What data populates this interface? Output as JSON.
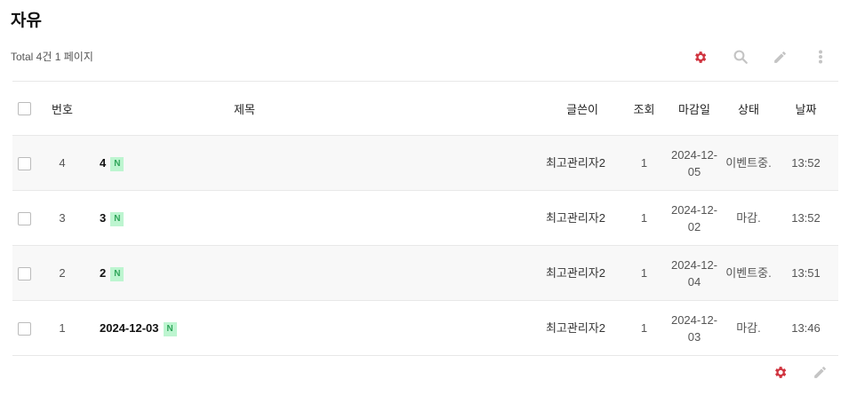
{
  "board": {
    "title": "자유",
    "total_text": "Total 4건 1 페이지"
  },
  "toolbar": {
    "icons": [
      "gear-icon",
      "search-icon",
      "pencil-icon",
      "more-vert-icon"
    ]
  },
  "columns": {
    "num": "번호",
    "subject": "제목",
    "author": "글쓴이",
    "views": "조회",
    "deadline": "마감일",
    "status": "상태",
    "date": "날짜"
  },
  "colors": {
    "accent": "#d0343f",
    "icon_gray": "#c4c4c4",
    "badge_bg": "#bdf5d0",
    "badge_text": "#2fa65a"
  },
  "rows": [
    {
      "num": "4",
      "subject": "4",
      "badge": "N",
      "author": "최고관리자2",
      "views": "1",
      "deadline": "2024-12-05",
      "status": "이벤트중.",
      "date": "13:52"
    },
    {
      "num": "3",
      "subject": "3",
      "badge": "N",
      "author": "최고관리자2",
      "views": "1",
      "deadline": "2024-12-02",
      "status": "마감.",
      "date": "13:52"
    },
    {
      "num": "2",
      "subject": "2",
      "badge": "N",
      "author": "최고관리자2",
      "views": "1",
      "deadline": "2024-12-04",
      "status": "이벤트중.",
      "date": "13:51"
    },
    {
      "num": "1",
      "subject": "2024-12-03",
      "badge": "N",
      "author": "최고관리자2",
      "views": "1",
      "deadline": "2024-12-03",
      "status": "마감.",
      "date": "13:46"
    }
  ]
}
